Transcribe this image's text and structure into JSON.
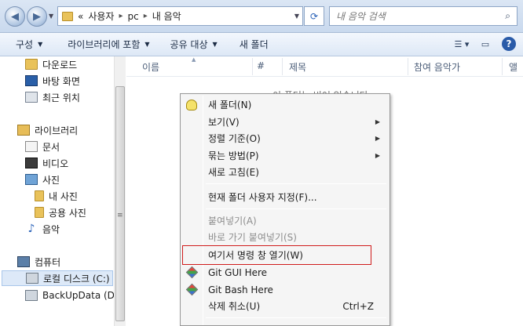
{
  "address": {
    "back_icon": "back-arrow-icon",
    "forward_icon": "forward-arrow-icon",
    "crumbs": [
      "«",
      "사용자",
      "pc",
      "내 음악"
    ],
    "search_placeholder": "내 음악 검색"
  },
  "toolbar": {
    "organize": "구성",
    "include_library": "라이브러리에 포함",
    "share_with": "공유 대상",
    "new_folder": "새 폴더"
  },
  "nav": {
    "downloads": "다운로드",
    "desktop": "바탕 화면",
    "recent": "최근 위치",
    "libraries": "라이브러리",
    "documents": "문서",
    "videos": "비디오",
    "pictures": "사진",
    "my_pictures": "내 사진",
    "public_pictures": "공용 사진",
    "music": "음악",
    "computer": "컴퓨터",
    "local_disk": "로컬 디스크 (C:)",
    "backup": "BackUpData (D:)"
  },
  "columns": [
    "이름",
    "#",
    "제목",
    "참여 음악가",
    "앨"
  ],
  "empty_message": "이 폴더는 비어 있습니다",
  "context_menu": {
    "new_folder": "새 폴더(N)",
    "view": "보기(V)",
    "sort_by": "정렬 기준(O)",
    "group_by": "묶는 방법(P)",
    "refresh": "새로 고침(E)",
    "customize": "현재 폴더 사용자 지정(F)...",
    "paste": "붙여넣기(A)",
    "paste_shortcut": "바로 가기 붙여넣기(S)",
    "open_cmd": "여기서 명령 창 열기(W)",
    "git_gui": "Git GUI Here",
    "git_bash": "Git Bash Here",
    "undo_delete": "삭제 취소(U)",
    "undo_shortcut": "Ctrl+Z"
  },
  "colors": {
    "highlight_border": "#d01c1c",
    "selection": "#dde9f8"
  }
}
